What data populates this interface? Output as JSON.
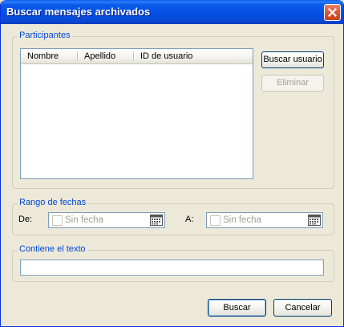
{
  "window": {
    "title": "Buscar mensajes archivados"
  },
  "participants": {
    "group_label": "Participantes",
    "columns": [
      "Nombre",
      "Apellido",
      "ID de usuario"
    ],
    "rows": [],
    "search_user_label": "Buscar usuario",
    "remove_label": "Eliminar"
  },
  "date_range": {
    "group_label": "Rango de fechas",
    "from_label": "De:",
    "from_value": "Sin fecha",
    "from_checked": false,
    "to_label": "A:",
    "to_value": "Sin fecha",
    "to_checked": false
  },
  "contains_text": {
    "group_label": "Contiene el texto",
    "value": ""
  },
  "footer": {
    "search_label": "Buscar",
    "cancel_label": "Cancelar"
  },
  "icons": {
    "close": "close-icon",
    "calendar": "calendar-icon"
  },
  "colors": {
    "title_bar": "#0550e6",
    "close_button": "#d95a3a",
    "group_label": "#0046d5",
    "dialog_background": "#ece9d8"
  }
}
